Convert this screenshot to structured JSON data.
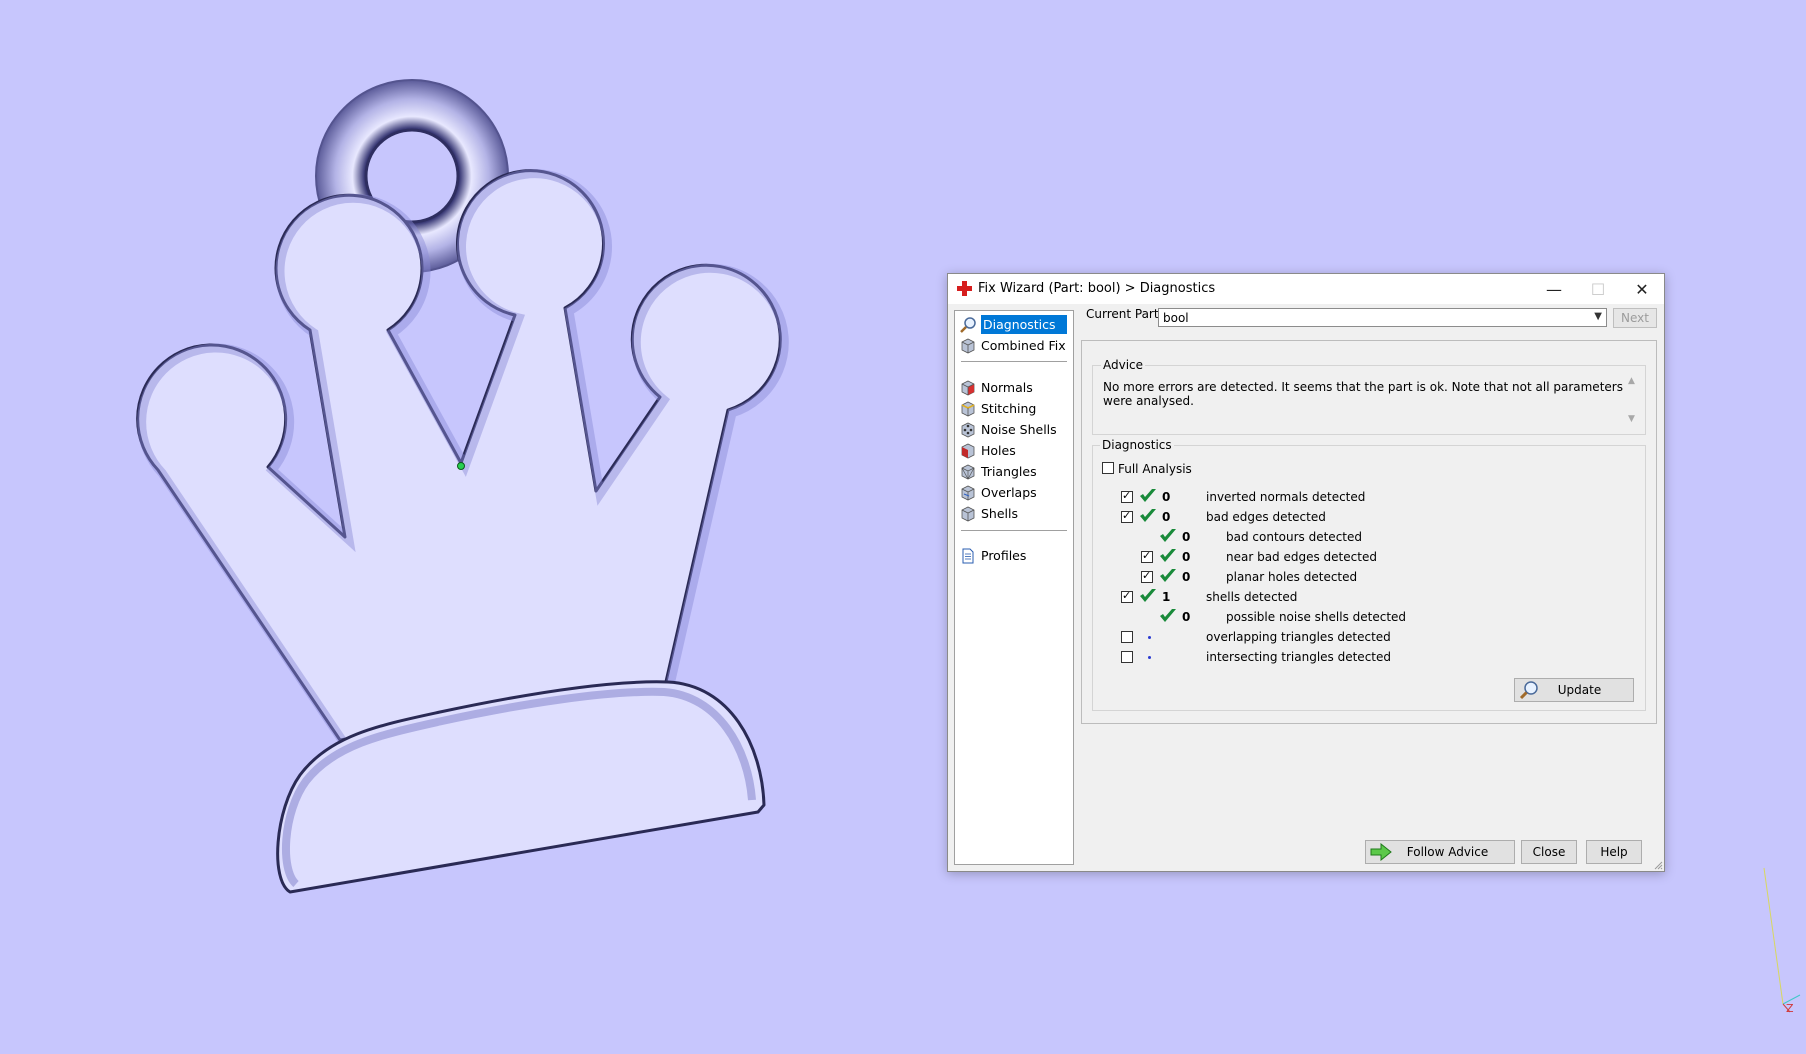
{
  "colors": {
    "background": "#c7c6fd",
    "crown_fill": "#dedefe",
    "crown_edge": "#5a5a9a",
    "accent": "#0078d7",
    "check_green": "#198a3a"
  },
  "dialog": {
    "title": "Fix Wizard (Part: bool) > Diagnostics",
    "title_icon": "red-cross-icon",
    "minimize": "—",
    "maximize": "☐",
    "close": "✕"
  },
  "nav": {
    "items_top": [
      {
        "label": "Diagnostics",
        "icon": "magnifier-icon",
        "selected": true
      },
      {
        "label": "Combined Fix",
        "icon": "cube-icon"
      }
    ],
    "items_mid": [
      {
        "label": "Normals",
        "icon": "cube-red-face-icon"
      },
      {
        "label": "Stitching",
        "icon": "cube-stitch-icon"
      },
      {
        "label": "Noise Shells",
        "icon": "cube-dots-icon"
      },
      {
        "label": "Holes",
        "icon": "cube-hole-icon"
      },
      {
        "label": "Triangles",
        "icon": "cube-triangles-icon"
      },
      {
        "label": "Overlaps",
        "icon": "cube-overlap-icon"
      },
      {
        "label": "Shells",
        "icon": "cube-shell-icon"
      }
    ],
    "items_bottom": [
      {
        "label": "Profiles",
        "icon": "document-icon"
      }
    ]
  },
  "current_part": {
    "label": "Current Part:",
    "value": "bool",
    "next_label": "Next"
  },
  "advice": {
    "title": "Advice",
    "text": "No more errors are detected. It seems that the part is ok. Note that not all parameters were analysed."
  },
  "diagnostics": {
    "title": "Diagnostics",
    "full_analysis_label": "Full Analysis",
    "rows": [
      {
        "checkbox": true,
        "status": "ok",
        "count": "0",
        "label": "inverted normals detected"
      },
      {
        "checkbox": true,
        "status": "ok",
        "count": "0",
        "label": "bad edges detected"
      },
      {
        "checkbox": null,
        "status": "ok",
        "count": "0",
        "label": "bad contours detected"
      },
      {
        "checkbox": true,
        "status": "ok",
        "count": "0",
        "label": "near bad edges detected"
      },
      {
        "checkbox": true,
        "status": "ok",
        "count": "0",
        "label": "planar holes detected"
      },
      {
        "checkbox": true,
        "status": "ok",
        "count": "1",
        "label": "shells detected"
      },
      {
        "checkbox": null,
        "status": "ok",
        "count": "0",
        "label": "possible noise shells detected"
      },
      {
        "checkbox": false,
        "status": "pending",
        "count": "",
        "label": "overlapping triangles detected"
      },
      {
        "checkbox": false,
        "status": "pending",
        "count": "",
        "label": "intersecting triangles detected"
      }
    ],
    "update_label": "Update"
  },
  "footer": {
    "follow_advice": "Follow Advice",
    "close": "Close",
    "help": "Help"
  },
  "axis": {
    "z_label": "Z"
  }
}
